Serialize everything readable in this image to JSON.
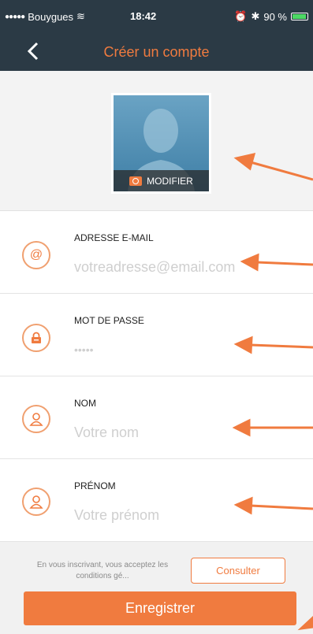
{
  "status": {
    "carrier": "Bouygues",
    "time": "18:42",
    "battery": "90 %"
  },
  "header": {
    "title": "Créer un compte"
  },
  "photo": {
    "modify_label": "MODIFIER"
  },
  "fields": [
    {
      "label": "ADRESSE E-MAIL",
      "placeholder": "votreadresse@email.com"
    },
    {
      "label": "MOT DE PASSE",
      "placeholder": "•••••"
    },
    {
      "label": "NOM",
      "placeholder": "Votre nom"
    },
    {
      "label": "PRÉNOM",
      "placeholder": "Votre prénom"
    }
  ],
  "footer": {
    "conditions": "En vous inscrivant, vous acceptez les conditions gé...",
    "consult_label": "Consulter",
    "save_label": "Enregistrer"
  },
  "colors": {
    "accent": "#f07b3f",
    "navbar": "#2b3a45"
  }
}
